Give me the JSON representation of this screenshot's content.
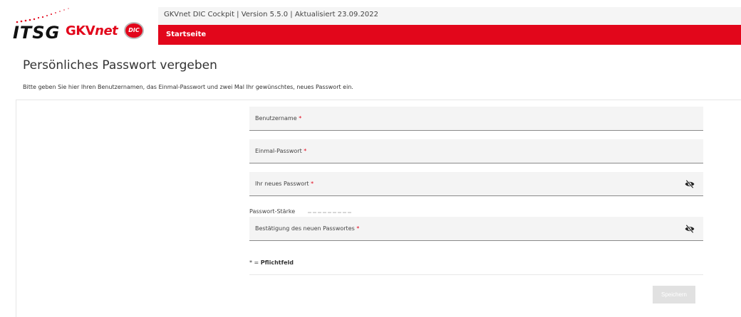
{
  "header": {
    "version_info": "GKVnet DIC Cockpit  |  Version 5.5.0  |  Aktualisiert 23.09.2022",
    "nav_tab": "Startseite",
    "logo_itsg": "ITSG",
    "logo_gkv": "GKV",
    "logo_net": "net",
    "logo_dic": "DIC"
  },
  "page": {
    "title": "Persönliches Passwort vergeben",
    "instruction": "Bitte geben Sie hier Ihren Benutzernamen, das Einmal-Passwort und zwei Mal Ihr gewünschtes, neues Passwort ein."
  },
  "form": {
    "username_label": "Benutzername",
    "onetime_label": "Einmal-Passwort",
    "new_password_label": "Ihr neues Passwort",
    "confirm_label": "Bestätigung des neuen Passwortes",
    "required_marker": "*",
    "strength_label": "Passwort-Stärke",
    "required_note_prefix": "* = ",
    "required_note": "Pflichtfeld",
    "save_label": "Speichern"
  },
  "colors": {
    "brand_red": "#e2061b",
    "field_bg": "#f4f4f4",
    "button_disabled": "#e1e1e1"
  },
  "icons": {
    "password_toggle": "eye-slash-icon"
  }
}
